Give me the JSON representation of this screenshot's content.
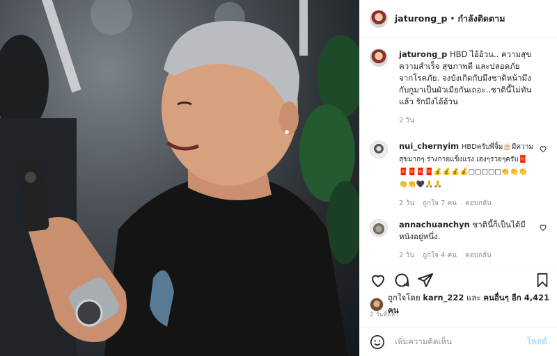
{
  "header": {
    "username": "jaturong_p",
    "separator": "•",
    "follow_status": "กำลังติดตาม"
  },
  "caption": {
    "username": "jaturong_p",
    "text": "HBD ไอ้อ้วน.. ความสุข ความสำเร็จ สุขภาพดี และปลอดภัยจากโรคภัย. จงบังเกิดกับมึงชาติหน้ามึงกับกูมาเป็นผัวเมียกันเถอะ..ชาตินี้ไม่ทันแล้ว รักมึงไอ้อ้วน",
    "age": "2 วัน"
  },
  "comments": [
    {
      "username": "nui_chernyim",
      "text": "HBDครับพี่จิ้ม🎂มีความสุขมากๆ ร่างกายแข็งแรง เฮงๆรวยๆครับ🧧🧧🧧🧧🧧💰💰💰💰□□□□□👏👏👏👏👏🖤🙏🙏",
      "age": "2 วัน",
      "likes": "ถูกใจ 7 คน",
      "reply": "ตอบกลับ"
    },
    {
      "username": "annachuanchyn",
      "text": "ชาตินี้ก็เป็นได้มีหนังอยู่หนึ่ง.",
      "age": "2 วัน",
      "likes": "ถูกใจ 4 คน",
      "reply": "ตอบกลับ"
    }
  ],
  "likes": {
    "prefix": "ถูกใจโดย",
    "user": "karn_222",
    "middle": "และ",
    "others": "คนอื่นๆ อีก 4,421 คน"
  },
  "post_time": "2 วันที่แล้ว",
  "add_comment": {
    "placeholder": "เพิ่มความคิดเห็น",
    "post_label": "โพสต์"
  },
  "icons": {
    "like": "heart-icon",
    "comment": "comment-icon",
    "share": "share-icon",
    "save": "bookmark-icon",
    "emoji": "emoji-icon"
  },
  "colors": {
    "text": "#262626",
    "muted": "#8e8e8e",
    "post_button": "#b2dffc",
    "border": "#efefef"
  }
}
